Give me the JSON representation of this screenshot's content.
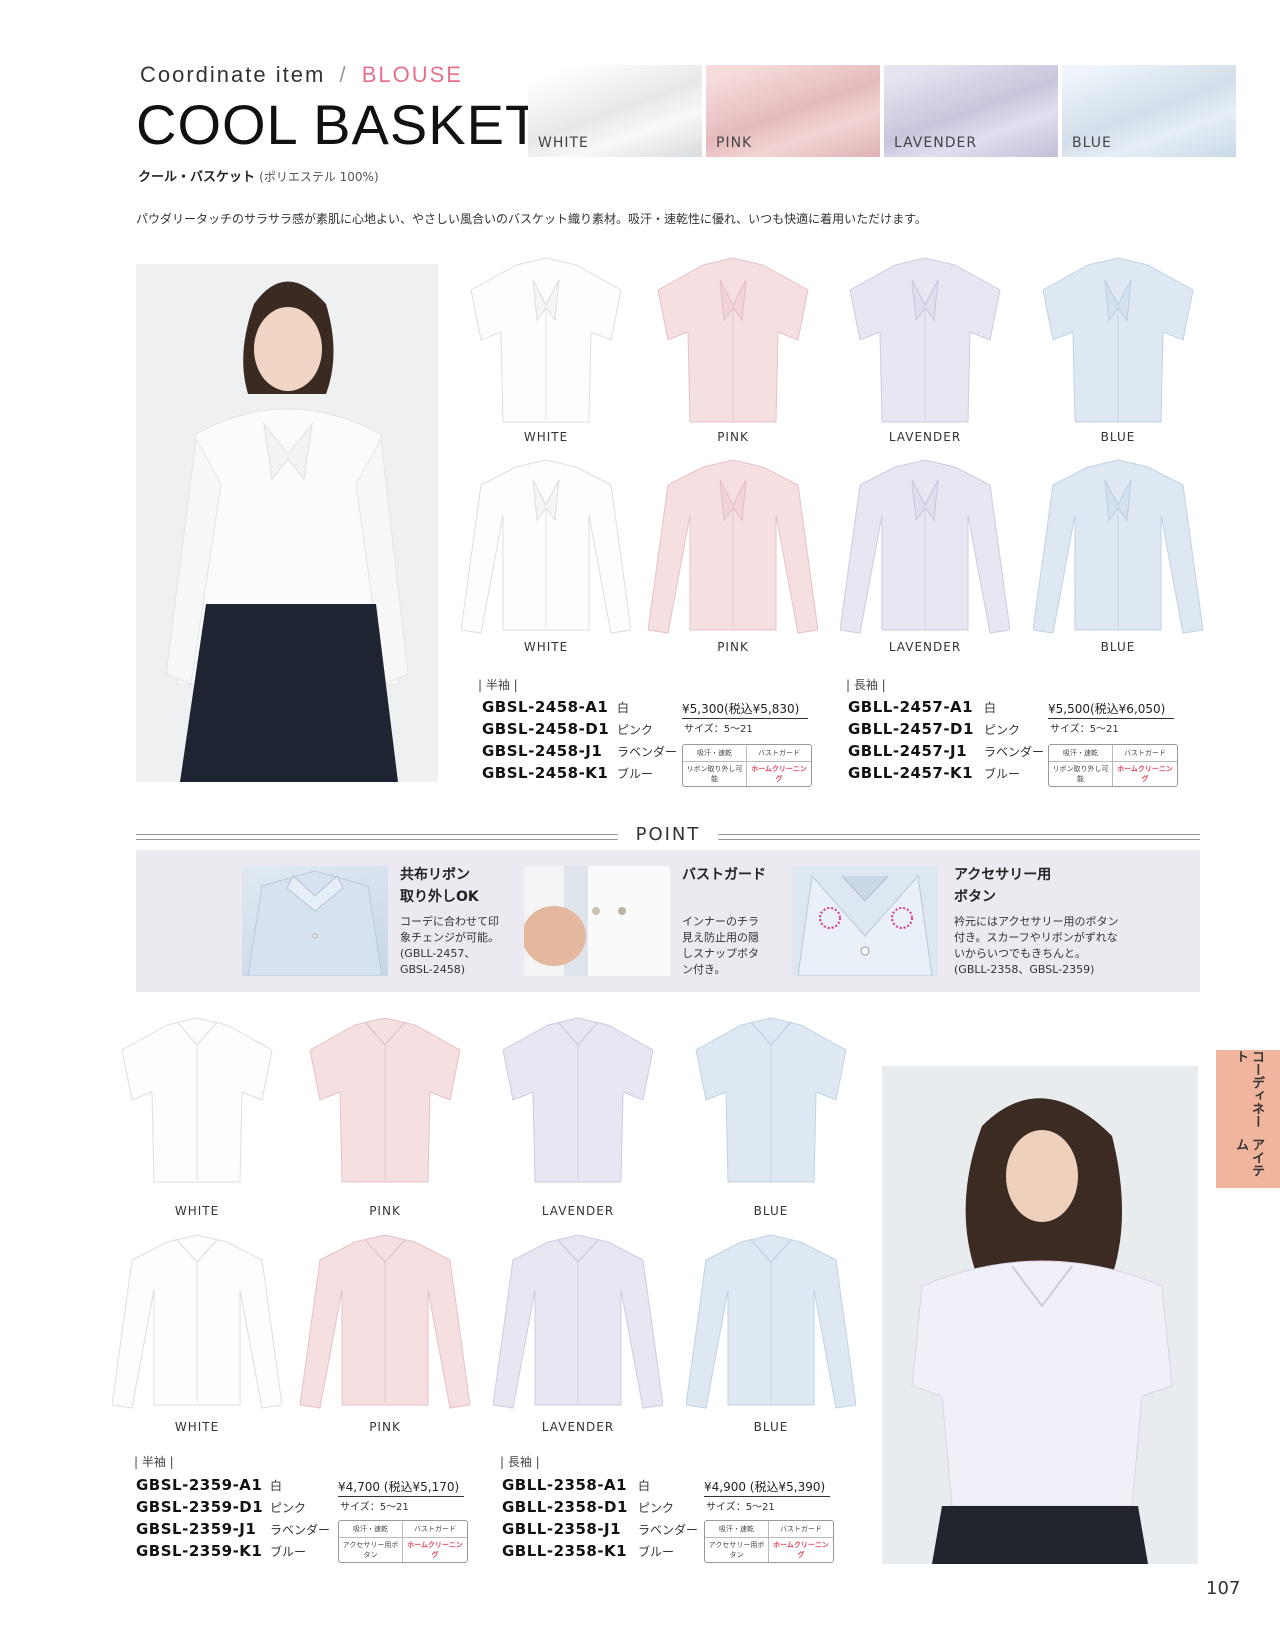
{
  "header": {
    "subtitle": "Coordinate item",
    "slash": "/",
    "category": "BLOUSE",
    "title": "COOL BASKET",
    "jp_name": "クール・バスケット",
    "material": "(ポリエステル 100%)",
    "description": "パウダリータッチのサラサラ感が素肌に心地よい、やさしい風合いのバスケット織り素材。吸汗・速乾性に優れ、いつも快適に着用いただけます。"
  },
  "swatches": [
    {
      "label": "WHITE",
      "color": "#f0f1f2"
    },
    {
      "label": "PINK",
      "color": "#ecc7c9"
    },
    {
      "label": "LAVENDER",
      "color": "#d6d3e6"
    },
    {
      "label": "BLUE",
      "color": "#d7e3ef"
    }
  ],
  "top_shirts": {
    "short": [
      "WHITE",
      "PINK",
      "LAVENDER",
      "BLUE"
    ],
    "long": [
      "WHITE",
      "PINK",
      "LAVENDER",
      "BLUE"
    ]
  },
  "top_products": {
    "short": {
      "label": "| 半袖 |",
      "codes": [
        "GBSL-2458-A1",
        "GBSL-2458-D1",
        "GBSL-2458-J1",
        "GBSL-2458-K1"
      ],
      "colors": [
        "白",
        "ピンク",
        "ラベンダー",
        "ブルー"
      ],
      "price": "¥5,300(税込¥5,830)",
      "size": "サイズ：5～21",
      "tags": [
        "吸汗・速乾",
        "バストガード",
        "リボン取り外し可能",
        "ホームクリーニング"
      ]
    },
    "long": {
      "label": "| 長袖 |",
      "codes": [
        "GBLL-2457-A1",
        "GBLL-2457-D1",
        "GBLL-2457-J1",
        "GBLL-2457-K1"
      ],
      "colors": [
        "白",
        "ピンク",
        "ラベンダー",
        "ブルー"
      ],
      "price": "¥5,500(税込¥6,050)",
      "size": "サイズ：5～21",
      "tags": [
        "吸汗・速乾",
        "バストガード",
        "リボン取り外し可能",
        "ホームクリーニング"
      ]
    }
  },
  "point": {
    "title": "POINT",
    "items": [
      {
        "head1": "共布リボン",
        "head2": "取り外しOK",
        "body": [
          "コーデに合わせて印",
          "象チェンジが可能。",
          "(GBLL-2457、",
          "GBSL-2458)"
        ]
      },
      {
        "head1": "バストガード",
        "head2": "",
        "body": [
          "インナーのチラ",
          "見え防止用の隠",
          "しスナップボタ",
          "ン付き。"
        ]
      },
      {
        "head1": "アクセサリー用",
        "head2": "ボタン",
        "body": [
          "衿元にはアクセサリー用のボタン",
          "付き。スカーフやリボンがずれな",
          "いからいつでもきちんと。",
          "(GBLL-2358、GBSL-2359)"
        ]
      }
    ]
  },
  "bottom_shirts": {
    "short": [
      "WHITE",
      "PINK",
      "LAVENDER",
      "BLUE"
    ],
    "long": [
      "WHITE",
      "PINK",
      "LAVENDER",
      "BLUE"
    ]
  },
  "bottom_products": {
    "short": {
      "label": "| 半袖 |",
      "codes": [
        "GBSL-2359-A1",
        "GBSL-2359-D1",
        "GBSL-2359-J1",
        "GBSL-2359-K1"
      ],
      "colors": [
        "白",
        "ピンク",
        "ラベンダー",
        "ブルー"
      ],
      "price": "¥4,700 (税込¥5,170)",
      "size": "サイズ：5～21",
      "tags": [
        "吸汗・速乾",
        "バストガード",
        "アクセサリー用ボタン",
        "ホームクリーニング"
      ]
    },
    "long": {
      "label": "| 長袖 |",
      "codes": [
        "GBLL-2358-A1",
        "GBLL-2358-D1",
        "GBLL-2358-J1",
        "GBLL-2358-K1"
      ],
      "colors": [
        "白",
        "ピンク",
        "ラベンダー",
        "ブルー"
      ],
      "price": "¥4,900 (税込¥5,390)",
      "size": "サイズ：5～21",
      "tags": [
        "吸汗・速乾",
        "バストガード",
        "アクセサリー用ボタン",
        "ホームクリーニング"
      ]
    }
  },
  "side_tab": {
    "line1": "コーディネート",
    "line2": "アイテム"
  },
  "page_number": "107"
}
